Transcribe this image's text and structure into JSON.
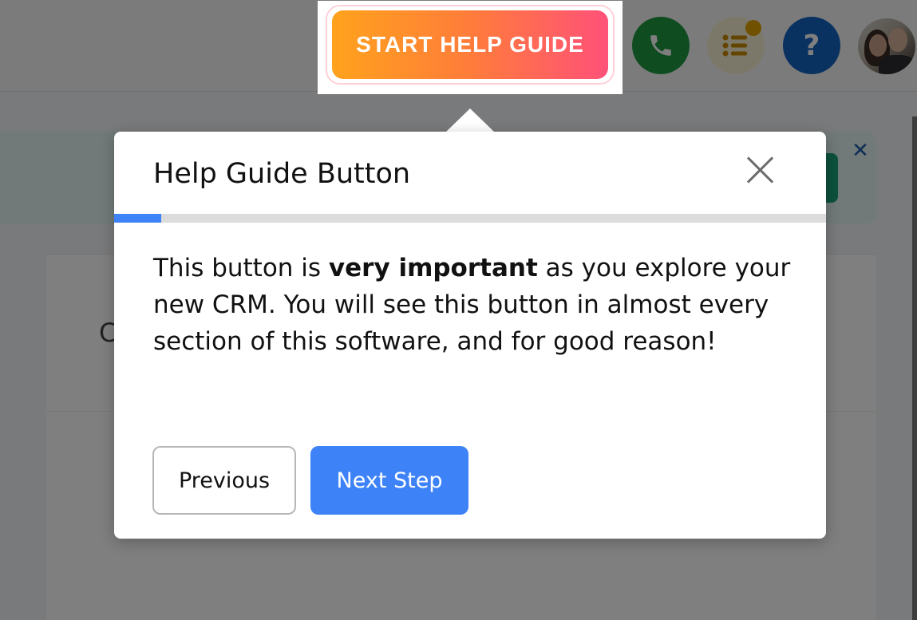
{
  "header": {
    "start_help_guide_label": "START HELP GUIDE",
    "help_label": "?",
    "icons": [
      "phone-icon",
      "tasks-icon",
      "help-icon",
      "avatar"
    ]
  },
  "background": {
    "partial_text": "C"
  },
  "tour": {
    "title": "Help Guide Button",
    "progress": 0.066,
    "body_parts": [
      "This button is ",
      "very important",
      " as you explore your new CRM. You will see this button in almost every section of this software, and for good reason!"
    ],
    "previous_label": "Previous",
    "next_label": "Next Step"
  },
  "colors": {
    "accent": "#3d82f7",
    "phone": "#1f9a43",
    "help": "#1565c0",
    "tasks_dot": "#e0a300",
    "help_guide_gradient_start": "#ffa21c",
    "help_guide_gradient_end": "#ff5179"
  }
}
